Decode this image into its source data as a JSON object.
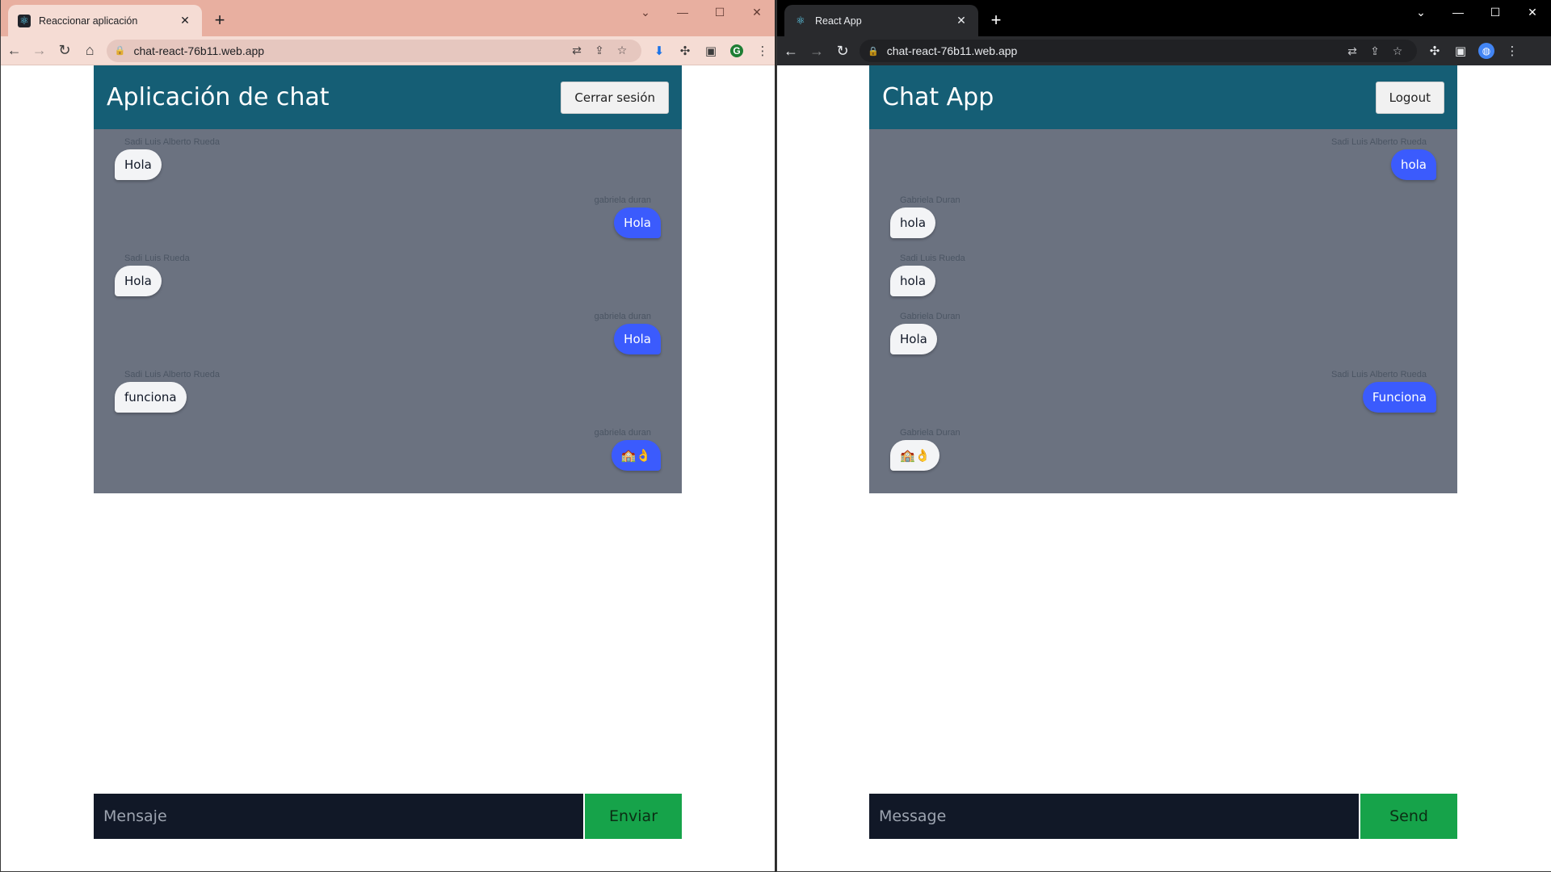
{
  "left": {
    "tab_title": "Reaccionar aplicación",
    "url": "chat-react-76b11.web.app",
    "app_title": "Aplicación de chat",
    "logout_label": "Cerrar sesión",
    "input_placeholder": "Mensaje",
    "send_label": "Enviar",
    "profile_initial": "G",
    "messages": [
      {
        "sender": "Sadi Luis Alberto Rueda",
        "text": "Hola",
        "side": "left"
      },
      {
        "sender": "gabriela duran",
        "text": "Hola",
        "side": "right"
      },
      {
        "sender": "Sadi Luis Rueda",
        "text": "Hola",
        "side": "left"
      },
      {
        "sender": "gabriela duran",
        "text": "Hola",
        "side": "right"
      },
      {
        "sender": "Sadi Luis Alberto Rueda",
        "text": "funciona",
        "side": "left"
      },
      {
        "sender": "gabriela duran",
        "text": "🏫👌",
        "side": "right"
      }
    ]
  },
  "right": {
    "tab_title": "React App",
    "url": "chat-react-76b11.web.app",
    "app_title": "Chat App",
    "logout_label": "Logout",
    "input_placeholder": "Message",
    "send_label": "Send",
    "messages": [
      {
        "sender": "Sadi Luis Alberto Rueda",
        "text": "hola",
        "side": "right"
      },
      {
        "sender": "Gabriela Duran",
        "text": "hola",
        "side": "left"
      },
      {
        "sender": "Sadi Luis Rueda",
        "text": "hola",
        "side": "left"
      },
      {
        "sender": "Gabriela Duran",
        "text": "Hola",
        "side": "left"
      },
      {
        "sender": "Sadi Luis Alberto Rueda",
        "text": "Funciona",
        "side": "right"
      },
      {
        "sender": "Gabriela Duran",
        "text": "🏫👌",
        "side": "left"
      }
    ]
  },
  "colors": {
    "header": "#155e75",
    "messages_bg": "#6b7280",
    "mine_bubble": "#3b5bfd",
    "other_bubble": "#f3f4f6",
    "input_bg": "#111827",
    "send_bg": "#16a34a"
  },
  "icons": {
    "favicon": "react-icon",
    "translate": "translate-icon",
    "share": "share-icon",
    "bookmark": "star-icon",
    "extensions": "puzzle-icon",
    "sidepanel": "side-panel-icon",
    "menu": "kebab-menu-icon"
  }
}
